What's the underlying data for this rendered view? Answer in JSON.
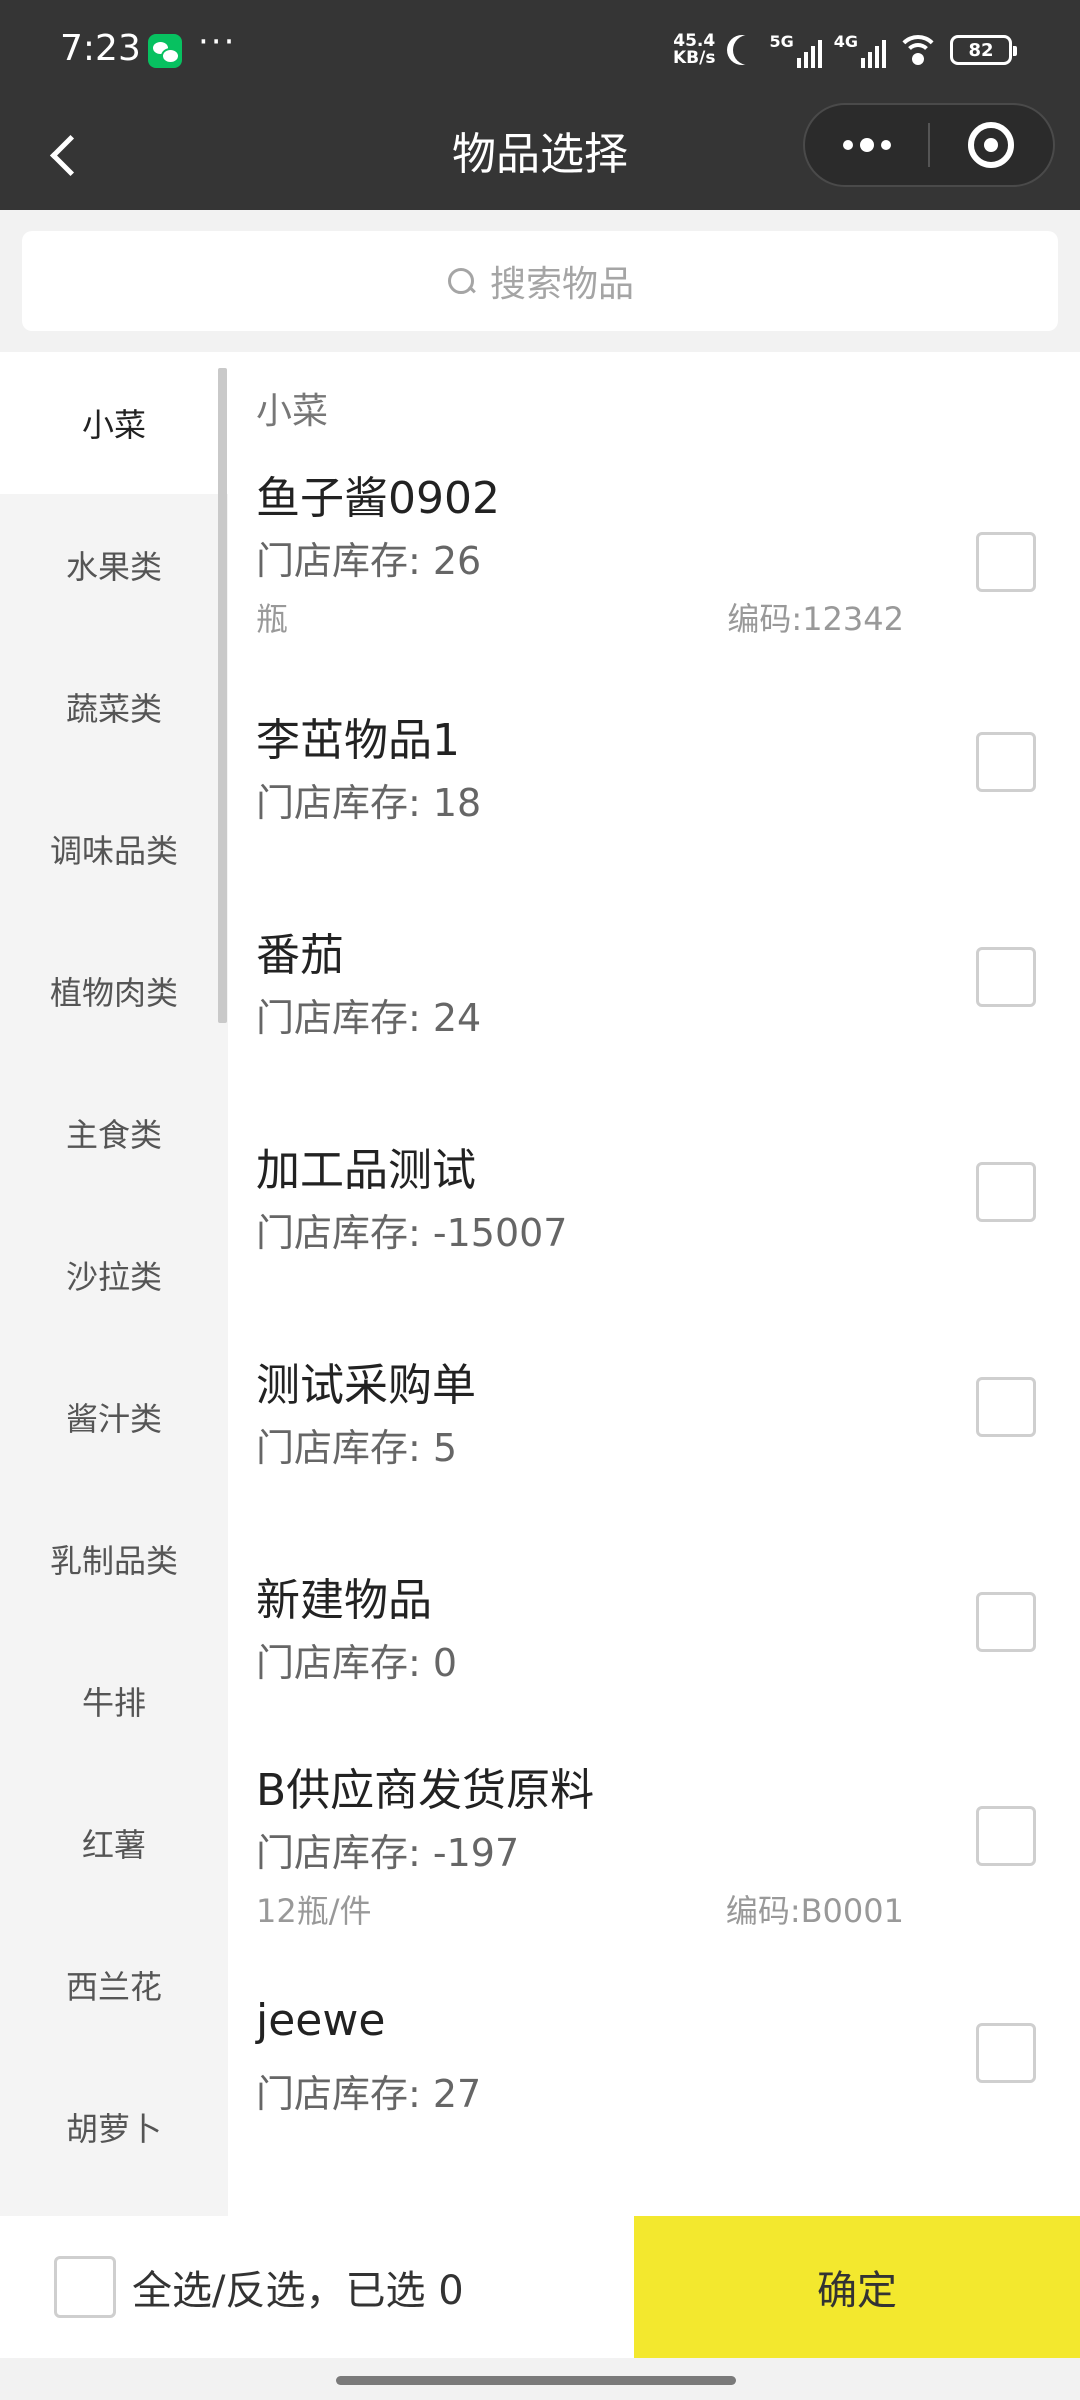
{
  "status_bar": {
    "time": "7:23",
    "dots": "···",
    "net_speed_value": "45.4",
    "net_speed_unit": "KB/s",
    "signal_1": "5G",
    "signal_2": "4G",
    "battery": "82"
  },
  "nav": {
    "title": "物品选择"
  },
  "search": {
    "placeholder": "搜索物品"
  },
  "sidebar": {
    "items": [
      {
        "label": "小菜",
        "active": true
      },
      {
        "label": "水果类"
      },
      {
        "label": "蔬菜类"
      },
      {
        "label": "调味品类"
      },
      {
        "label": "植物肉类"
      },
      {
        "label": "主食类"
      },
      {
        "label": "沙拉类"
      },
      {
        "label": "酱汁类"
      },
      {
        "label": "乳制品类"
      },
      {
        "label": "牛排"
      },
      {
        "label": "红薯"
      },
      {
        "label": "西兰花"
      },
      {
        "label": "胡萝卜"
      }
    ]
  },
  "main": {
    "category_title": "小菜",
    "items": [
      {
        "name": "鱼子酱0902",
        "stock": "门店库存: 26",
        "unit": "瓶",
        "code": "编码:12342"
      },
      {
        "name": "李茁物品1",
        "stock": "门店库存: 18"
      },
      {
        "name": "番茄",
        "stock": "门店库存: 24"
      },
      {
        "name": "加工品测试",
        "stock": "门店库存: -15007"
      },
      {
        "name": "测试采购单",
        "stock": "门店库存: 5"
      },
      {
        "name": "新建物品",
        "stock": "门店库存: 0"
      },
      {
        "name": "B供应商发货原料",
        "stock": "门店库存: -197",
        "unit": "12瓶/件",
        "code": "编码:B0001"
      },
      {
        "name": "jeewe",
        "stock": "门店库存: 27"
      }
    ]
  },
  "footer": {
    "select_all_label": "全选/反选，已选 0",
    "confirm_label": "确定"
  },
  "colors": {
    "header_bg": "#353535",
    "confirm_bg": "#f3e82e"
  }
}
